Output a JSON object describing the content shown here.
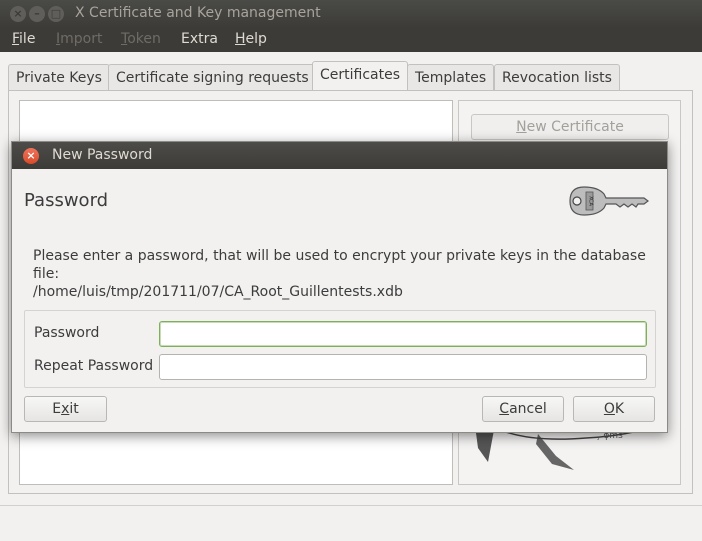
{
  "window": {
    "title": "X Certificate and Key management",
    "controls": [
      "close",
      "minimize",
      "maximize"
    ]
  },
  "menubar": {
    "items": [
      {
        "label": "File",
        "mnemonic": "F",
        "rest": "ile",
        "enabled": true
      },
      {
        "label": "Import",
        "mnemonic": "I",
        "rest": "mport",
        "enabled": false
      },
      {
        "label": "Token",
        "mnemonic": "T",
        "rest": "oken",
        "enabled": false
      },
      {
        "label": "Extra",
        "mnemonic": "",
        "rest": "Extra",
        "enabled": true
      },
      {
        "label": "Help",
        "mnemonic": "H",
        "rest": "elp",
        "enabled": true
      }
    ]
  },
  "tabs": [
    {
      "label": "Private Keys",
      "active": false
    },
    {
      "label": "Certificate signing requests",
      "active": false
    },
    {
      "label": "Certificates",
      "active": true
    },
    {
      "label": "Templates",
      "active": false
    },
    {
      "label": "Revocation lists",
      "active": false
    }
  ],
  "side_panel": {
    "new_certificate": {
      "mnemonic": "N",
      "rest": "ew Certificate",
      "enabled": false
    }
  },
  "dialog": {
    "title": "New Password",
    "heading": "Password",
    "message_line1": "Please enter a password, that will be used to encrypt your private keys in the database file:",
    "message_line2": "/home/luis/tmp/201711/07/CA_Root_Guillentests.xdb",
    "fields": [
      {
        "label": "Password",
        "value": "",
        "focused": true
      },
      {
        "label": "Repeat Password",
        "value": "",
        "focused": false
      }
    ],
    "buttons": {
      "exit": {
        "pre": "E",
        "mnemonic": "x",
        "rest": "it"
      },
      "cancel": {
        "pre": "",
        "mnemonic": "C",
        "rest": "ancel"
      },
      "ok": {
        "pre": "",
        "mnemonic": "O",
        "rest": "K"
      }
    },
    "icon": "key-icon"
  },
  "colors": {
    "titlebar": "#3c3b37",
    "close_button": "#df4a16",
    "focus_border": "#7fae5c",
    "window_bg": "#f2f1f0"
  }
}
